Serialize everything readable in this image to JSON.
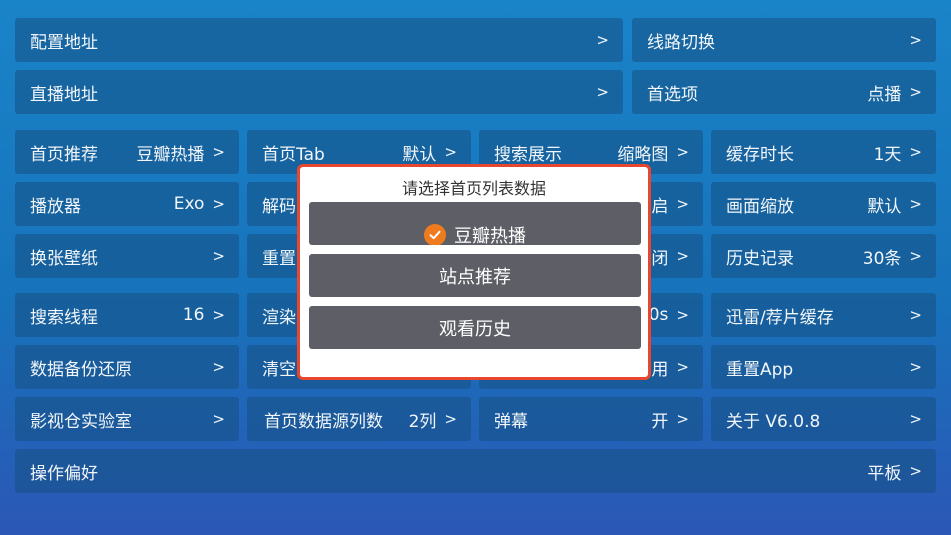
{
  "rows": {
    "config_address": {
      "label": "配置地址",
      "value": "",
      "chevron": ">"
    },
    "line_switch": {
      "label": "线路切换",
      "value": "",
      "chevron": ">"
    },
    "live_address": {
      "label": "直播地址",
      "value": "",
      "chevron": ">"
    },
    "preferences": {
      "label": "首选项",
      "value": "点播",
      "chevron": ">"
    },
    "home_recommend": {
      "label": "首页推荐",
      "value": "豆瓣热播",
      "chevron": ">"
    },
    "home_tab": {
      "label": "首页Tab",
      "value": "默认",
      "chevron": ">"
    },
    "search_display": {
      "label": "搜索展示",
      "value": "缩略图",
      "chevron": ">"
    },
    "cache_duration": {
      "label": "缓存时长",
      "value": "1天",
      "chevron": ">"
    },
    "player": {
      "label": "播放器",
      "value": "Exo",
      "chevron": ">"
    },
    "decode": {
      "label": "解码",
      "value": "启",
      "chevron": ">"
    },
    "screen_zoom": {
      "label": "画面缩放",
      "value": "默认",
      "chevron": ">"
    },
    "change_wallpaper": {
      "label": "换张壁纸",
      "value": "",
      "chevron": ">"
    },
    "reset": {
      "label": "重置",
      "value": "闭",
      "chevron": ">"
    },
    "history": {
      "label": "历史记录",
      "value": "30条",
      "chevron": ">"
    },
    "search_threads": {
      "label": "搜索线程",
      "value": "16",
      "chevron": ">"
    },
    "render": {
      "label": "渲染",
      "value": "0s",
      "chevron": ">"
    },
    "thunder_cache": {
      "label": "迅雷/荐片缓存",
      "value": "",
      "chevron": ">"
    },
    "data_backup": {
      "label": "数据备份还原",
      "value": "",
      "chevron": ">"
    },
    "clear_cache": {
      "label": "清空",
      "value": "用",
      "chevron": ">"
    },
    "reset_app": {
      "label": "重置App",
      "value": "",
      "chevron": ">"
    },
    "lab": {
      "label": "影视仓实验室",
      "value": "",
      "chevron": ">"
    },
    "home_source_cols": {
      "label": "首页数据源列数",
      "value": "2列",
      "chevron": ">"
    },
    "danmaku": {
      "label": "弹幕",
      "value": "开",
      "chevron": ">"
    },
    "about": {
      "label": "关于 V6.0.8",
      "value": "",
      "chevron": ">"
    },
    "operation_pref": {
      "label": "操作偏好",
      "value": "平板",
      "chevron": ">"
    }
  },
  "dialog": {
    "title": "请选择首页列表数据",
    "options": [
      "豆瓣热播",
      "站点推荐",
      "观看历史"
    ],
    "selected_index": 0
  },
  "colors": {
    "dialog_border": "#e8472f",
    "option_bg": "#5e5f66",
    "check_color": "#f07a1e"
  }
}
